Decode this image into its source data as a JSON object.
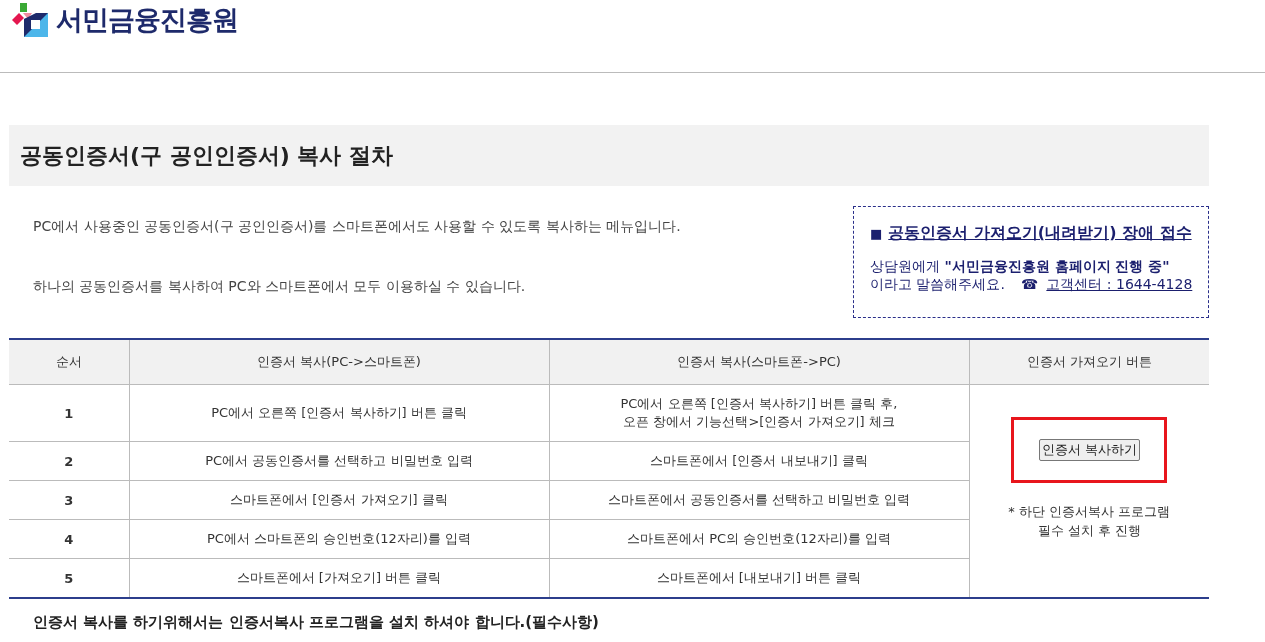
{
  "logo": {
    "text": "서민금융진흥원"
  },
  "title": "공동인증서(구 공인인증서) 복사 절차",
  "intro": [
    "PC에서 사용중인 공동인증서(구 공인인증서)를 스마트폰에서도 사용할 수 있도록 복사하는 메뉴입니다.",
    "하나의 공동인증서를 복사하여 PC와 스마트폰에서 모두 이용하실 수 있습니다."
  ],
  "notice": {
    "bullet": "■",
    "link": "공동인증서 가져오기(내려받기) 장애 접수",
    "line1_prefix": "상담원에게 ",
    "line1_bold": "\"서민금융진흥원 홈페이지 진행 중\"",
    "line2": "이라고 말씀해주세요.",
    "phone_icon": "☎",
    "phone_link": "고객센터 : 1644-4128"
  },
  "table": {
    "columns": [
      "순서",
      "인증서 복사(PC->스마트폰)",
      "인증서 복사(스마트폰->PC)",
      "인증서 가져오기 버튼"
    ],
    "rows": [
      {
        "step": "1",
        "pc_to_phone": "PC에서 오른쪽 [인증서 복사하기] 버튼 클릭",
        "phone_to_pc": [
          "PC에서 오른쪽 [인증서 복사하기] 버튼 클릭 후,",
          "오픈 창에서 기능선택>[인증서 가져오기] 체크"
        ]
      },
      {
        "step": "2",
        "pc_to_phone": "PC에서 공동인증서를 선택하고 비밀번호 입력",
        "phone_to_pc": [
          "스마트폰에서 [인증서 내보내기] 클릭"
        ]
      },
      {
        "step": "3",
        "pc_to_phone": "스마트폰에서 [인증서 가져오기] 클릭",
        "phone_to_pc": [
          "스마트폰에서 공동인증서를 선택하고 비밀번호 입력"
        ]
      },
      {
        "step": "4",
        "pc_to_phone": "PC에서 스마트폰의 승인번호(12자리)를 입력",
        "phone_to_pc": [
          "스마트폰에서 PC의 승인번호(12자리)를 입력"
        ]
      },
      {
        "step": "5",
        "pc_to_phone": "스마트폰에서 [가져오기] 버튼 클릭",
        "phone_to_pc": [
          "스마트폰에서 [내보내기] 버튼 클릭"
        ]
      }
    ],
    "button": {
      "label": "인증서 복사하기",
      "highlighted": true
    },
    "button_note": [
      "* 하단 인증서복사 프로그램",
      "필수 설치 후 진행"
    ]
  },
  "footer_note": "인증서 복사를 하기위해서는 인증서복사 프로그램을 설치 하셔야 합니다.(필수사항)"
}
